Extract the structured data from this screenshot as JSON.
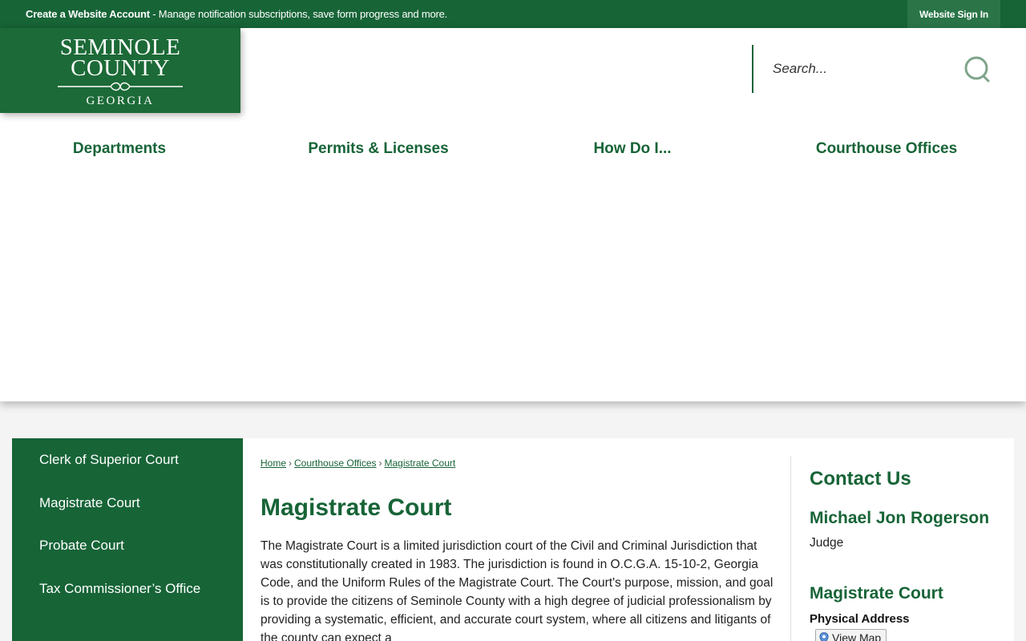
{
  "topbar": {
    "create_account": "Create a Website Account",
    "message": " - Manage notification subscriptions, save form progress and more.",
    "signin": "Website Sign In"
  },
  "logo": {
    "line1": "SEMINOLE",
    "line2": "COUNTY",
    "line3": "GEORGIA"
  },
  "search": {
    "placeholder": "Search...",
    "icon": "search-icon"
  },
  "nav": {
    "items": [
      "Departments",
      "Permits & Licenses",
      "How Do I...",
      "Courthouse Offices"
    ]
  },
  "sidebar": {
    "items": [
      "Clerk of Superior Court",
      "Magistrate Court",
      "Probate Court",
      "Tax Commissioner’s Office"
    ]
  },
  "breadcrumb": {
    "items": [
      "Home",
      "Courthouse Offices",
      "Magistrate Court"
    ],
    "separator": "›"
  },
  "main": {
    "title": "Magistrate Court",
    "body": "The Magistrate Court is a limited jurisdiction court of the Civil and Criminal Jurisdiction that was constitutionally created in 1983. The jurisdiction is found in O.C.G.A. 15-10-2, Georgia Code, and the Uniform Rules of the Magistrate Court. The Court's purpose, mission, and goal is to provide the citizens of Seminole County with a high degree of judicial professionalism by providing a systematic, efficient, and accurate court system, where all citizens and litigants of the county can expect a"
  },
  "contact": {
    "title": "Contact Us",
    "person_name": "Michael Jon Rogerson",
    "person_role": "Judge",
    "office_name": "Magistrate Court",
    "address_label": "Physical Address",
    "view_map": "View Map"
  },
  "colors": {
    "brand_green": "#176437",
    "signin_bg": "#2a7447"
  }
}
